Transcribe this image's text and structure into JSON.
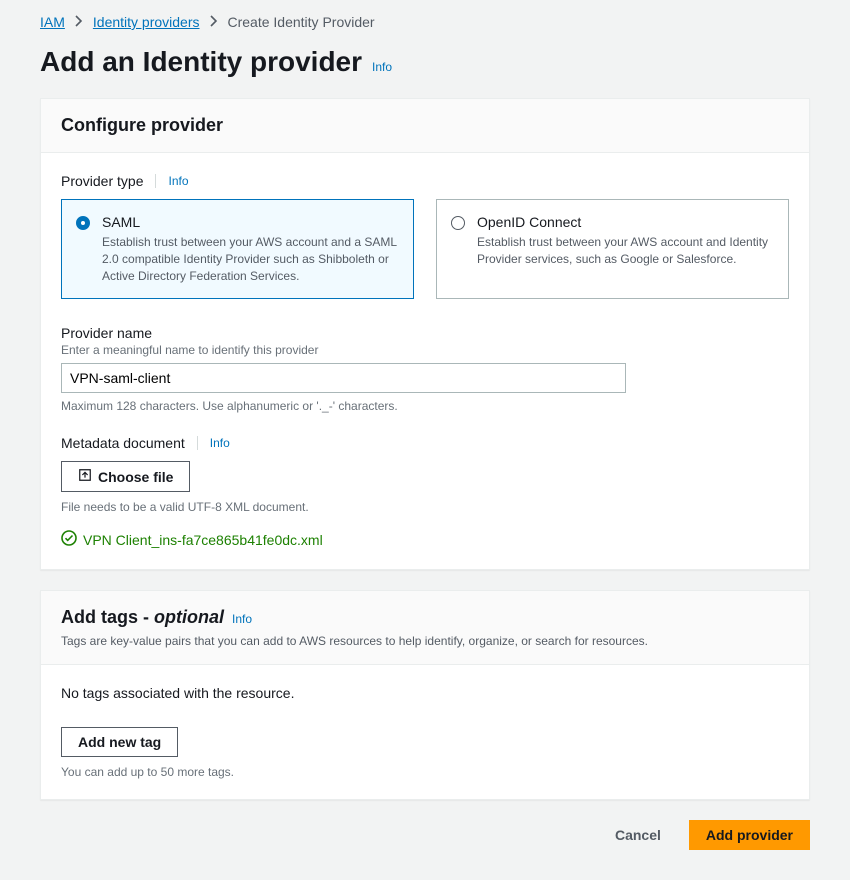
{
  "breadcrumb": {
    "iam": "IAM",
    "idp": "Identity providers",
    "current": "Create Identity Provider"
  },
  "page": {
    "title": "Add an Identity provider",
    "info": "Info"
  },
  "configure": {
    "heading": "Configure provider",
    "provider_type_label": "Provider type",
    "info": "Info",
    "saml": {
      "title": "SAML",
      "desc": "Establish trust between your AWS account and a SAML 2.0 compatible Identity Provider such as Shibboleth or Active Directory Federation Services."
    },
    "oidc": {
      "title": "OpenID Connect",
      "desc": "Establish trust between your AWS account and Identity Provider services, such as Google or Salesforce."
    },
    "provider_name_label": "Provider name",
    "provider_name_hint": "Enter a meaningful name to identify this provider",
    "provider_name_value": "VPN-saml-client",
    "provider_name_constraint": "Maximum 128 characters. Use alphanumeric or '._-' characters.",
    "metadata_label": "Metadata document",
    "choose_file": "Choose file",
    "metadata_hint": "File needs to be a valid UTF-8 XML document.",
    "uploaded_file": "VPN Client_ins-fa7ce865b41fe0dc.xml"
  },
  "tags": {
    "heading_prefix": "Add tags - ",
    "heading_optional": "optional",
    "info": "Info",
    "sub": "Tags are key-value pairs that you can add to AWS resources to help identify, organize, or search for resources.",
    "empty": "No tags associated with the resource.",
    "add_button": "Add new tag",
    "limit": "You can add up to 50 more tags."
  },
  "footer": {
    "cancel": "Cancel",
    "submit": "Add provider"
  }
}
